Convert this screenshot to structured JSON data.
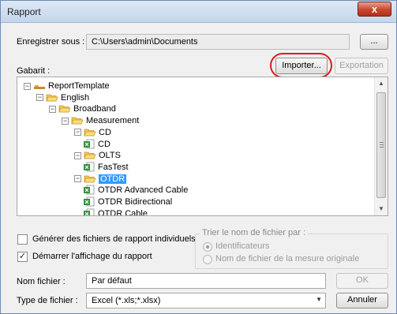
{
  "window": {
    "title": "Rapport",
    "close_label": "x"
  },
  "save_as": {
    "label": "Enregistrer sous :",
    "path": "C:\\Users\\admin\\Documents",
    "browse_label": "..."
  },
  "template": {
    "label": "Gabarit :",
    "import_label": "Importer...",
    "export_label": "Exportation"
  },
  "tree": {
    "items": [
      {
        "label": "ReportTemplate",
        "level": 0,
        "kind": "root"
      },
      {
        "label": "English",
        "level": 1,
        "kind": "folder"
      },
      {
        "label": "Broadband",
        "level": 2,
        "kind": "folder"
      },
      {
        "label": "Measurement",
        "level": 3,
        "kind": "folder"
      },
      {
        "label": "CD",
        "level": 4,
        "kind": "folder"
      },
      {
        "label": "CD",
        "level": 5,
        "kind": "doc"
      },
      {
        "label": "OLTS",
        "level": 4,
        "kind": "folder"
      },
      {
        "label": "FasTest",
        "level": 5,
        "kind": "doc"
      },
      {
        "label": "OTDR",
        "level": 4,
        "kind": "folder",
        "selected": true
      },
      {
        "label": "OTDR Advanced Cable",
        "level": 5,
        "kind": "doc"
      },
      {
        "label": "OTDR Bidirectional",
        "level": 5,
        "kind": "doc"
      },
      {
        "label": "OTDR Cable",
        "level": 5,
        "kind": "doc"
      }
    ]
  },
  "options": {
    "individual_reports": {
      "label": "Générer des fichiers de rapport individuels",
      "checked": false
    },
    "start_display": {
      "label": "Démarrer l'affichage du rapport",
      "checked": true
    }
  },
  "sort": {
    "legend": "Trier le nom de fichier par :",
    "by_identifiers": "Identificateurs",
    "by_measure_name": "Nom de fichier de la mesure originale"
  },
  "file": {
    "name_label": "Nom fichier :",
    "name_value": "Par défaut",
    "ok_label": "OK",
    "type_label": "Type de fichier :",
    "type_value": "Excel (*.xls;*.xlsx)",
    "cancel_label": "Annuler"
  },
  "colors": {
    "selection": "#3399ff",
    "highlight_oval": "#d81e1e",
    "folder": "#f3c64f"
  }
}
